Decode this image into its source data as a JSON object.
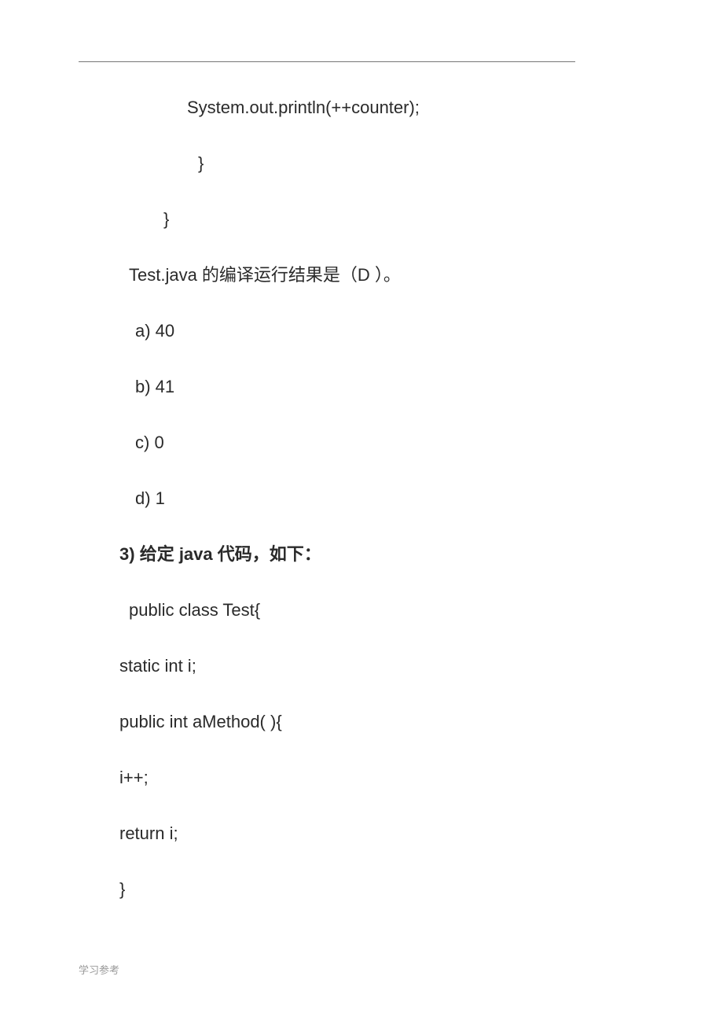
{
  "lines": {
    "code1": "System.out.println(++counter);",
    "brace1": "}",
    "brace2": "}",
    "question": "Test.java 的编译运行结果是（D ）。",
    "opt_a": "a) 40",
    "opt_b": "b) 41",
    "opt_c": "c) 0",
    "opt_d": "d) 1"
  },
  "q3": {
    "prefix": "3) ",
    "mid1": "给定 ",
    "bold_java": "java ",
    "mid2": "代码，如下：",
    "code": {
      "l1": "public class Test{",
      "l2": "static int i;",
      "l3": "public int aMethod( ){",
      "l4": "i++;",
      "l5": "return i;",
      "l6": "}"
    }
  },
  "footer": "学习参考"
}
